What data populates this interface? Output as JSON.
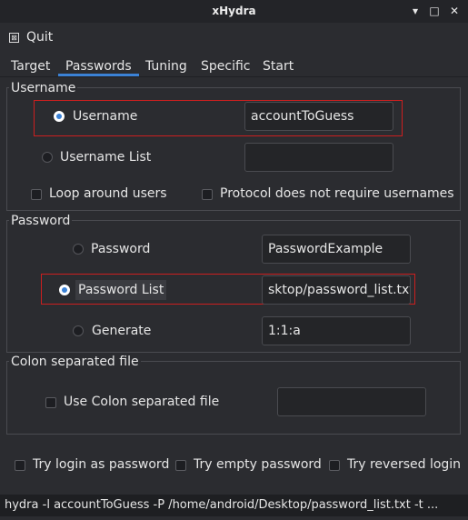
{
  "window": {
    "title": "xHydra",
    "minimize": "▾",
    "maximize": "□",
    "close": "✕"
  },
  "menu": {
    "quit_icon": "⊠",
    "quit": "Quit"
  },
  "tabs": [
    "Target",
    "Passwords",
    "Tuning",
    "Specific",
    "Start"
  ],
  "username_group": {
    "title": "Username",
    "username_label": "Username",
    "username_value": "accountToGuess",
    "username_list_label": "Username List",
    "username_list_value": "",
    "loop_users": "Loop around users",
    "protocol_no_user": "Protocol does not require usernames"
  },
  "password_group": {
    "title": "Password",
    "password_label": "Password",
    "password_value": "PasswordExample",
    "password_list_label": "Password List",
    "password_list_value": "sktop/password_list.txt",
    "generate_label": "Generate",
    "generate_value": "1:1:a"
  },
  "colon_group": {
    "title": "Colon separated file",
    "use_colon": "Use Colon separated file",
    "colon_value": ""
  },
  "options": {
    "try_login": "Try login as password",
    "try_empty": "Try empty password",
    "try_reversed": "Try reversed login"
  },
  "command": "hydra -l accountToGuess -P /home/android/Desktop/password_list.txt -t ...",
  "colors": {
    "accent": "#3b82d6",
    "highlight": "#cc1f1f",
    "background": "#2b2c30"
  }
}
